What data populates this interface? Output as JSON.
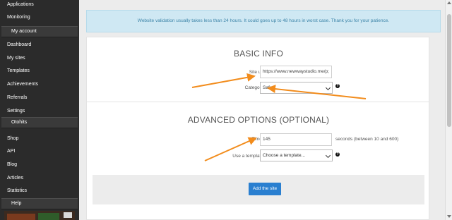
{
  "sidebar": {
    "items": [
      {
        "label": "Applications"
      },
      {
        "label": "Monitoring"
      },
      {
        "label": "My account",
        "section": true
      },
      {
        "label": "Dashboard"
      },
      {
        "label": "My sites"
      },
      {
        "label": "Templates"
      },
      {
        "label": "Achievements"
      },
      {
        "label": "Referrals"
      },
      {
        "label": "Settings"
      },
      {
        "label": "Otohits",
        "section": true
      },
      {
        "label": "Shop"
      },
      {
        "label": "API"
      },
      {
        "label": "Blog"
      },
      {
        "label": "Articles"
      },
      {
        "label": "Statistics"
      },
      {
        "label": "Help",
        "section": true
      }
    ]
  },
  "alert": {
    "text": "Website validation usually takes less than 24 hours. It could goes up to 48 hours in worst case. Thank you for your patience."
  },
  "basic": {
    "title": "BASIC INFO",
    "site_url_label": "Site url",
    "site_url_value": "https://www.newwaystudio.me/p;",
    "category_label": "Category",
    "category_value": "Safe"
  },
  "advanced": {
    "title": "ADVANCED OPTIONS (OPTIONAL)",
    "timer_label": "Timer",
    "timer_value": "145",
    "timer_hint": "seconds (between 10 and 600)",
    "template_label": "Use a template",
    "template_value": "Choose a template..."
  },
  "actions": {
    "add_site_label": "Add the site"
  },
  "colors": {
    "sidebar_bg": "#2b2b2b",
    "alert_bg": "#cfe8f3",
    "alert_text": "#3c84a8",
    "primary": "#2a7fd0",
    "annotation_arrow": "#f28c1c"
  },
  "icons": {
    "help": "question-circle-icon",
    "dropdown": "chevron-down-icon"
  }
}
